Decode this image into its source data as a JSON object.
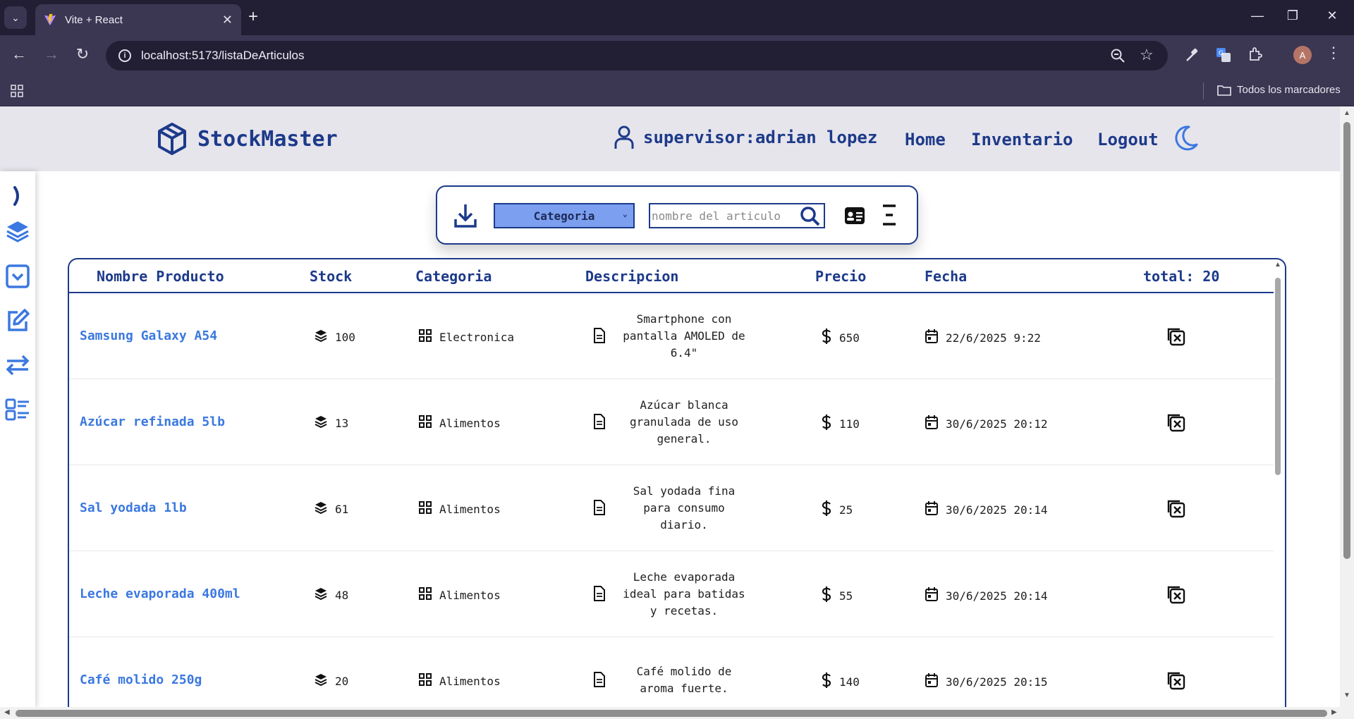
{
  "browser": {
    "tab_title": "Vite + React",
    "url": "localhost:5173/listaDeArticulos",
    "bookmarks_label": "Todos los marcadores",
    "profile_initial": "A"
  },
  "header": {
    "brand": "StockMaster",
    "user": "supervisor:adrian lopez",
    "nav": [
      "Home",
      "Inventario",
      "Logout"
    ]
  },
  "sidebar": {
    "items": [
      "expand-chevron",
      "layers",
      "dropdown-box",
      "edit",
      "transfer",
      "list-detail"
    ]
  },
  "filters": {
    "select_value": "Categoria",
    "search_placeholder": "nombre del articulo"
  },
  "table": {
    "headers": [
      "Nombre Producto",
      "Stock",
      "Categoria",
      "Descripcion",
      "Precio",
      "Fecha",
      "total: 20"
    ],
    "rows": [
      {
        "name": "Samsung Galaxy A54",
        "stock": "100",
        "category": "Electronica",
        "desc_lines": [
          "Smartphone con",
          "pantalla AMOLED de",
          "6.4\""
        ],
        "price": "650",
        "date": "22/6/2025 9:22"
      },
      {
        "name": "Azúcar refinada 5lb",
        "stock": "13",
        "category": "Alimentos",
        "desc_lines": [
          "Azúcar blanca",
          "granulada de uso",
          "general."
        ],
        "price": "110",
        "date": "30/6/2025 20:12"
      },
      {
        "name": "Sal yodada 1lb",
        "stock": "61",
        "category": "Alimentos",
        "desc_lines": [
          "Sal yodada fina",
          "para consumo",
          "diario."
        ],
        "price": "25",
        "date": "30/6/2025 20:14"
      },
      {
        "name": "Leche evaporada 400ml",
        "stock": "48",
        "category": "Alimentos",
        "desc_lines": [
          "Leche evaporada",
          "ideal para batidas",
          "y recetas."
        ],
        "price": "55",
        "date": "30/6/2025 20:14"
      },
      {
        "name": "Café molido 250g",
        "stock": "20",
        "category": "Alimentos",
        "desc_lines": [
          "Café molido de",
          "aroma fuerte."
        ],
        "price": "140",
        "date": "30/6/2025 20:15"
      }
    ]
  },
  "colors": {
    "primary": "#1d3a8a",
    "link": "#3b78e0",
    "accent": "#7c9ff0",
    "header_bg": "#e6e5ec"
  }
}
